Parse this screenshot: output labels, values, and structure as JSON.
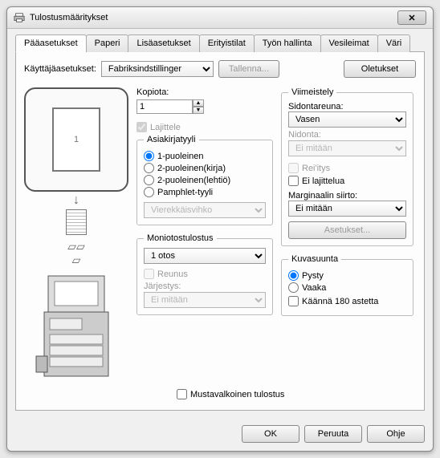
{
  "window": {
    "title": "Tulostusmääritykset"
  },
  "tabs": {
    "main": "Pääasetukset",
    "paper": "Paperi",
    "advanced": "Lisäasetukset",
    "special": "Erityistilat",
    "job": "Työn hallinta",
    "watermarks": "Vesileimat",
    "color": "Väri"
  },
  "userSettings": {
    "label": "Käyttäjäasetukset:",
    "value": "Fabriksindstillinger",
    "saveBtn": "Tallenna...",
    "defaultsBtn": "Oletukset"
  },
  "preview": {
    "pageNumber": "1"
  },
  "copies": {
    "label": "Kopiota:",
    "value": "1"
  },
  "collate": {
    "label": "Lajittele"
  },
  "docStyle": {
    "legend": "Asiakirjatyyli",
    "opt1": "1-puoleinen",
    "opt2": "2-puoleinen(kirja)",
    "opt3": "2-puoleinen(lehtiö)",
    "opt4": "Pamphlet-tyyli",
    "combo": "Vierekkäisvihko"
  },
  "nup": {
    "legend": "Moniotostulostus",
    "value": "1 otos",
    "border": "Reunus",
    "orderLabel": "Järjestys:",
    "orderValue": "Ei mitään"
  },
  "finishing": {
    "legend": "Viimeistely",
    "bindingLabel": "Sidontareuna:",
    "bindingValue": "Vasen",
    "stapleLabel": "Nidonta:",
    "stapleValue": "Ei mitään",
    "punch": "Rei'itys",
    "noOffset": "Ei lajittelua",
    "marginLabel": "Marginaalin siirto:",
    "marginValue": "Ei mitään",
    "settingsBtn": "Asetukset..."
  },
  "orientation": {
    "legend": "Kuvasuunta",
    "portrait": "Pysty",
    "landscape": "Vaaka",
    "rotate": "Käännä 180 astetta"
  },
  "bw": {
    "label": "Mustavalkoinen tulostus"
  },
  "buttons": {
    "ok": "OK",
    "cancel": "Peruuta",
    "help": "Ohje"
  }
}
